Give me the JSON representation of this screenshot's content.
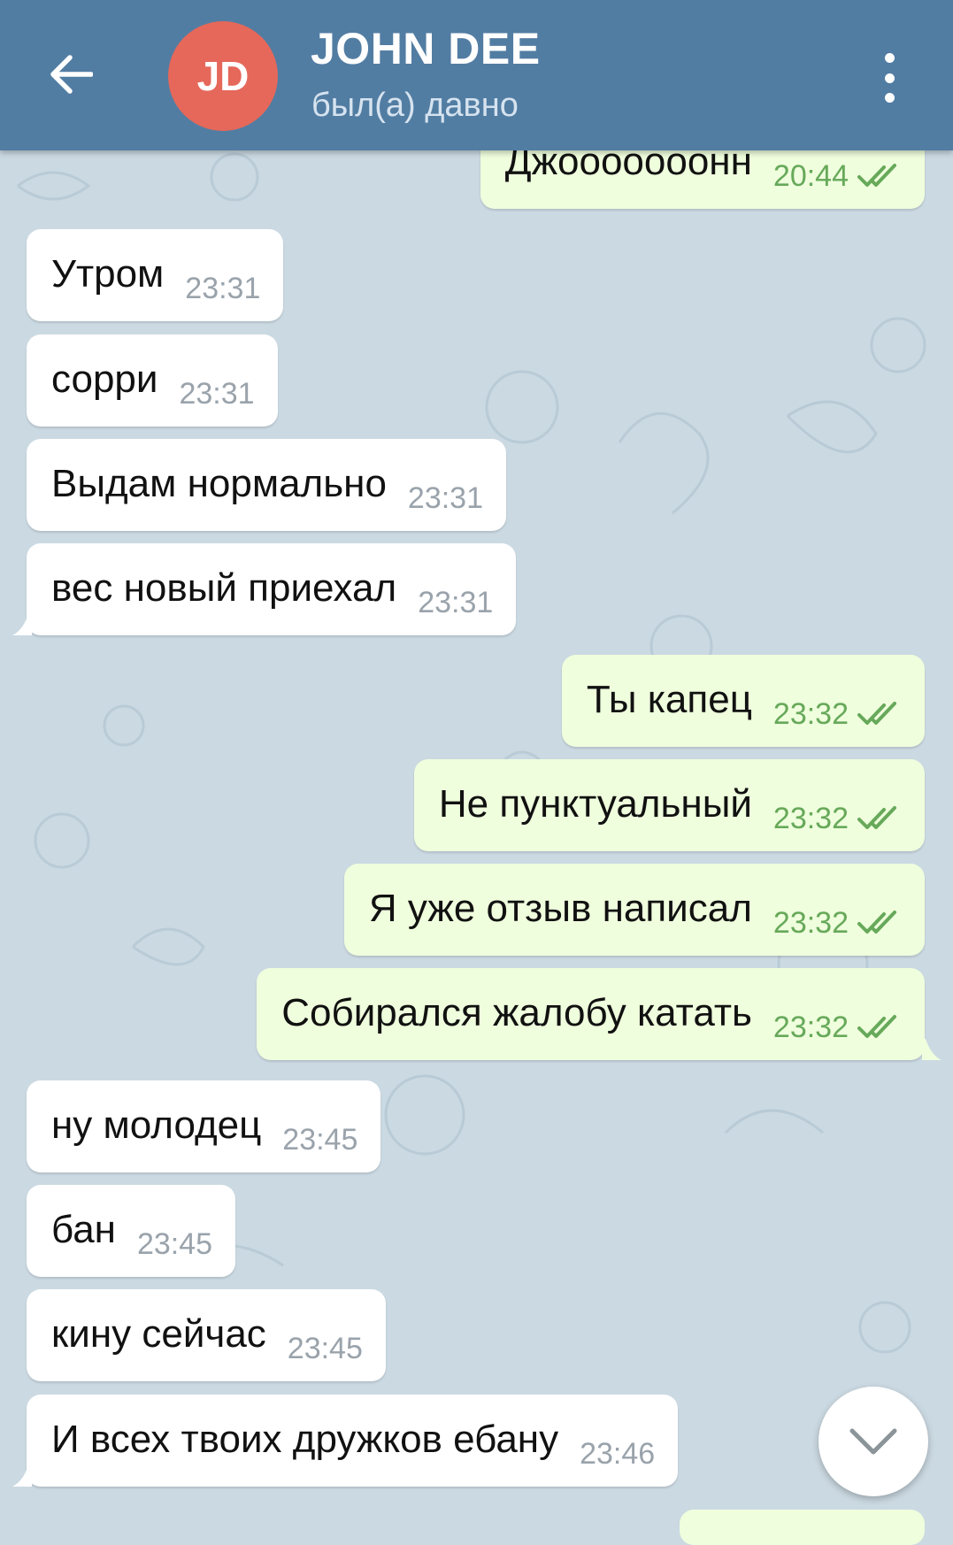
{
  "header": {
    "avatar_initials": "JD",
    "avatar_color": "#e5685a",
    "title": "JOHN DEE",
    "status": "был(а) давно",
    "bar_color": "#527da3",
    "back_icon": "arrow-left-icon",
    "menu_icon": "more-vertical-icon"
  },
  "messages": [
    {
      "direction": "out",
      "text": "Джооооооонн",
      "time": "20:44",
      "read": true
    },
    {
      "direction": "in",
      "text": "Утром",
      "time": "23:31"
    },
    {
      "direction": "in",
      "text": "сорри",
      "time": "23:31"
    },
    {
      "direction": "in",
      "text": "Выдам нормально",
      "time": "23:31"
    },
    {
      "direction": "in",
      "text": "вес новый приехал",
      "time": "23:31"
    },
    {
      "direction": "out",
      "text": "Ты капец",
      "time": "23:32",
      "read": true
    },
    {
      "direction": "out",
      "text": "Не пунктуальный",
      "time": "23:32",
      "read": true
    },
    {
      "direction": "out",
      "text": "Я уже отзыв написал",
      "time": "23:32",
      "read": true
    },
    {
      "direction": "out",
      "text": "Собирался жалобу катать",
      "time": "23:32",
      "read": true
    },
    {
      "direction": "in",
      "text": "ну молодец",
      "time": "23:45"
    },
    {
      "direction": "in",
      "text": "бан",
      "time": "23:45"
    },
    {
      "direction": "in",
      "text": "кину сейчас",
      "time": "23:45"
    },
    {
      "direction": "in",
      "text": "И всех твоих дружков ебану",
      "time": "23:46"
    }
  ],
  "colors": {
    "incoming_bubble": "#ffffff",
    "outgoing_bubble": "#effedd",
    "outgoing_time": "#67a95a",
    "incoming_time": "#9aa3ab",
    "chat_background": "#cbd9e2"
  },
  "scroll_down_icon": "chevron-down-icon"
}
